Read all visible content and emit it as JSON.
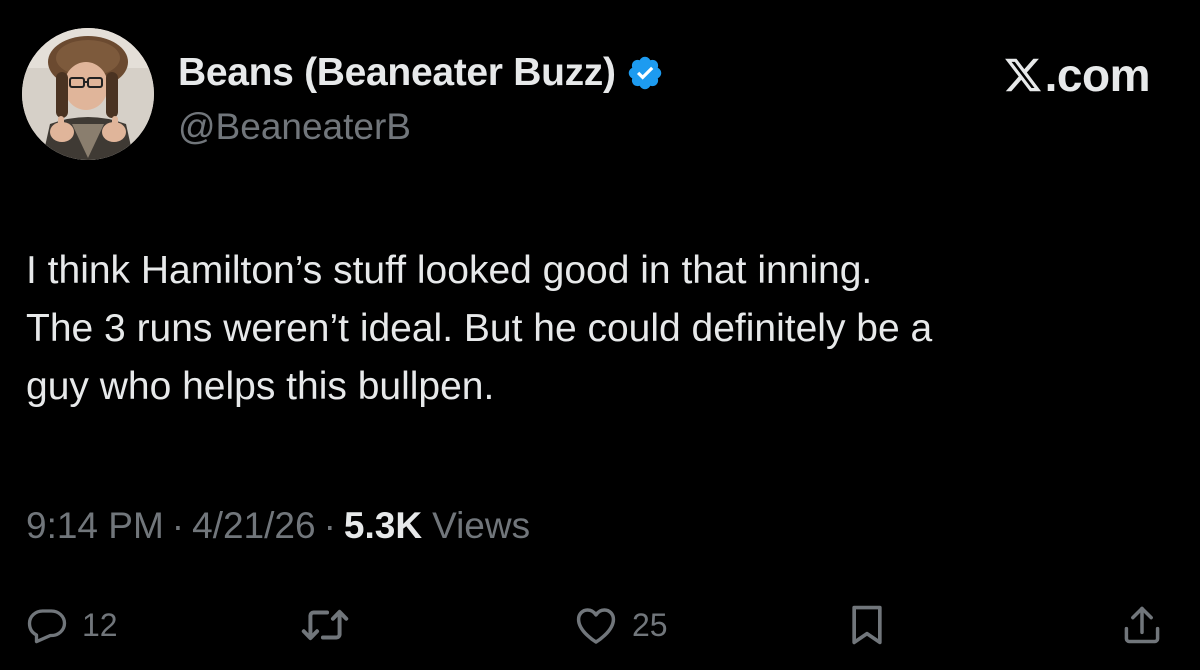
{
  "author": {
    "display_name": "Beans (Beaneater Buzz)",
    "handle": "@BeaneaterB",
    "verified": true,
    "avatar_icon": "profile-photo-avatar"
  },
  "brand": {
    "label": ".com",
    "logo_icon": "x-logo-icon"
  },
  "tweet": {
    "lines": [
      "I think Hamilton’s stuff looked good in that inning.",
      "The 3 runs weren’t ideal. But he could definitely be a",
      "guy who helps this bullpen."
    ]
  },
  "meta": {
    "time": "9:14 PM",
    "date": "4/21/26",
    "separator": "·",
    "views_count": "5.3K",
    "views_label": "Views"
  },
  "actions": {
    "reply": {
      "icon": "reply-icon",
      "count": "12"
    },
    "retweet": {
      "icon": "retweet-icon",
      "count": ""
    },
    "like": {
      "icon": "heart-icon",
      "count": "25"
    },
    "bookmark": {
      "icon": "bookmark-icon"
    },
    "share": {
      "icon": "share-icon"
    }
  },
  "colors": {
    "background": "#000000",
    "text_primary": "#e7e9ea",
    "text_secondary": "#71767b",
    "verified_blue": "#1d9bf0"
  }
}
